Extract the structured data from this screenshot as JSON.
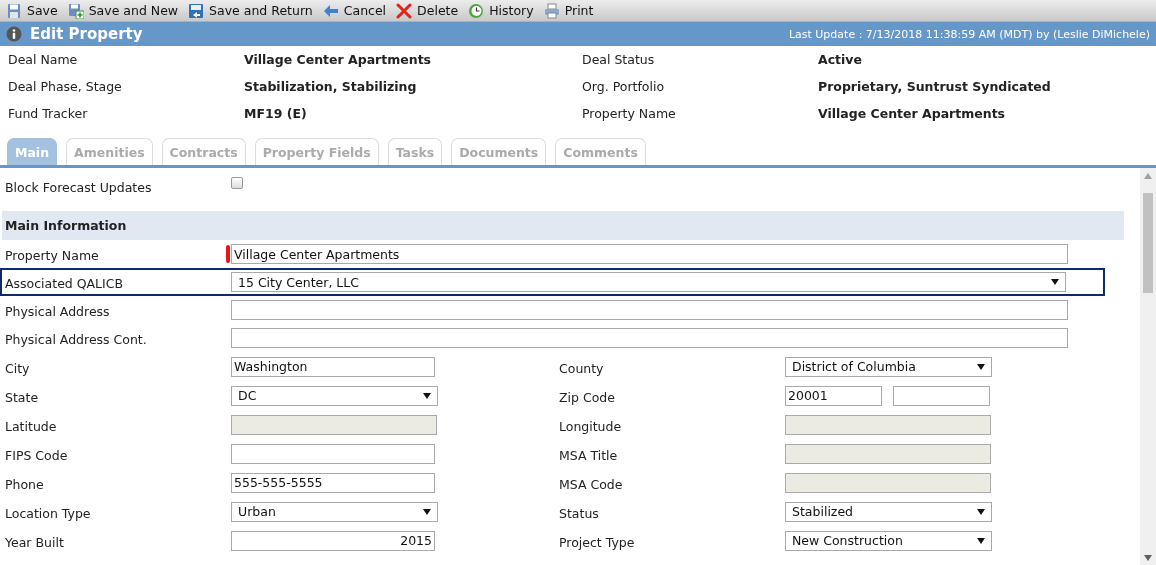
{
  "toolbar": [
    {
      "label": "Save",
      "kind": "save"
    },
    {
      "label": "Save and New",
      "kind": "save-new"
    },
    {
      "label": "Save and Return",
      "kind": "save-return"
    },
    {
      "label": "Cancel",
      "kind": "cancel"
    },
    {
      "label": "Delete",
      "kind": "delete"
    },
    {
      "label": "History",
      "kind": "history"
    },
    {
      "label": "Print",
      "kind": "print"
    }
  ],
  "header": {
    "title": "Edit Property",
    "last_update": "Last Update : 7/13/2018 11:38:59 AM (MDT) by (Leslie DiMichele)"
  },
  "summary": [
    {
      "label": "Deal Name",
      "value": "Village Center Apartments"
    },
    {
      "label": "Deal Status",
      "value": "Active"
    },
    {
      "label": "Deal Phase, Stage",
      "value": "Stabilization, Stabilizing"
    },
    {
      "label": "Org. Portfolio",
      "value": "Proprietary, Suntrust Syndicated"
    },
    {
      "label": "Fund Tracker",
      "value": "MF19 (E)"
    },
    {
      "label": "Property Name",
      "value": "Village Center Apartments"
    }
  ],
  "tabs": [
    {
      "label": "Main",
      "selected": true
    },
    {
      "label": "Amenities",
      "selected": false
    },
    {
      "label": "Contracts",
      "selected": false
    },
    {
      "label": "Property Fields",
      "selected": false
    },
    {
      "label": "Tasks",
      "selected": false
    },
    {
      "label": "Documents",
      "selected": false
    },
    {
      "label": "Comments",
      "selected": false
    }
  ],
  "block_forecast": {
    "label": "Block Forecast Updates",
    "checked": false
  },
  "section": {
    "title": "Main Information"
  },
  "wide_rows": [
    {
      "label": "Property Name",
      "required": true,
      "focused": false,
      "field": {
        "kind": "text",
        "value": "Village Center Apartments"
      }
    },
    {
      "label": "Associated QALICB",
      "required": false,
      "focused": true,
      "field": {
        "kind": "select",
        "value": "15 City Center, LLC"
      }
    },
    {
      "label": "Physical Address",
      "required": false,
      "focused": false,
      "field": {
        "kind": "text"
      }
    },
    {
      "label": "Physical Address Cont.",
      "required": false,
      "focused": false,
      "field": {
        "kind": "text"
      }
    }
  ],
  "pair_rows": [
    {
      "left": {
        "label": "City",
        "field": {
          "kind": "text",
          "value": "Washington"
        }
      },
      "right": {
        "label": "County",
        "field": {
          "kind": "select",
          "value": "District of Columbia"
        }
      }
    },
    {
      "left": {
        "label": "State",
        "field": {
          "kind": "select",
          "value": "DC"
        }
      },
      "right": {
        "label": "Zip Code",
        "field": {
          "kind": "zip",
          "value": "20001"
        }
      }
    },
    {
      "left": {
        "label": "Latitude",
        "field": {
          "kind": "readonly"
        }
      },
      "right": {
        "label": "Longitude",
        "field": {
          "kind": "readonly"
        }
      }
    },
    {
      "left": {
        "label": "FIPS Code",
        "field": {
          "kind": "text"
        }
      },
      "right": {
        "label": "MSA Title",
        "field": {
          "kind": "readonly"
        }
      }
    },
    {
      "left": {
        "label": "Phone",
        "field": {
          "kind": "text",
          "value": "555-555-5555"
        }
      },
      "right": {
        "label": "MSA Code",
        "field": {
          "kind": "readonly"
        }
      }
    },
    {
      "left": {
        "label": "Location Type",
        "field": {
          "kind": "select",
          "value": "Urban"
        }
      },
      "right": {
        "label": "Status",
        "field": {
          "kind": "select",
          "value": "Stabilized"
        }
      }
    },
    {
      "left": {
        "label": "Year Built",
        "field": {
          "kind": "number",
          "value": "2015"
        }
      },
      "right": {
        "label": "Project Type",
        "field": {
          "kind": "select",
          "value": "New Construction"
        }
      }
    }
  ]
}
